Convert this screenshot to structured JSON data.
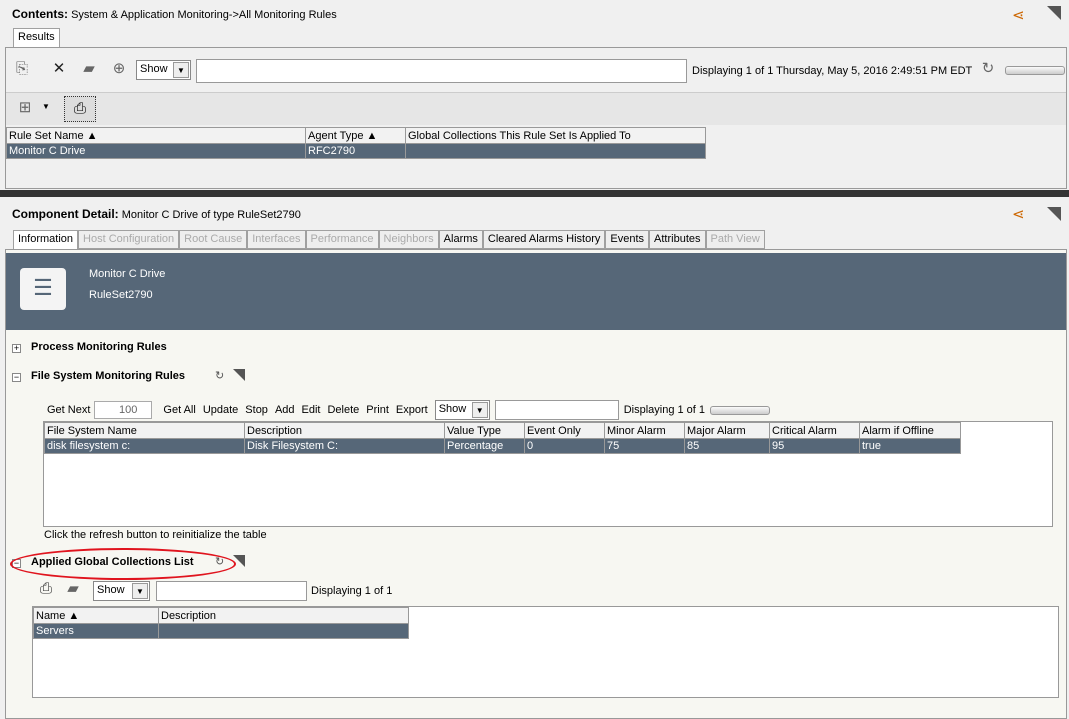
{
  "top": {
    "label": "Contents:",
    "path": "System & Application Monitoring->All Monitoring Rules",
    "tab": "Results",
    "show": "Show",
    "status": "Displaying 1 of 1 Thursday, May 5, 2016 2:49:51 PM EDT",
    "columns": [
      "Rule Set Name",
      "Agent Type",
      "Global Collections This Rule Set Is Applied To"
    ],
    "rows": [
      [
        "Monitor C Drive",
        "RFC2790",
        ""
      ]
    ]
  },
  "detail": {
    "label": "Component Detail:",
    "subject": "Monitor C Drive of type RuleSet2790",
    "tabs": [
      {
        "label": "Information",
        "state": "active"
      },
      {
        "label": "Host Configuration",
        "state": "disabled"
      },
      {
        "label": "Root Cause",
        "state": "disabled"
      },
      {
        "label": "Interfaces",
        "state": "disabled"
      },
      {
        "label": "Performance",
        "state": "disabled"
      },
      {
        "label": "Neighbors",
        "state": "disabled"
      },
      {
        "label": "Alarms",
        "state": "enabled"
      },
      {
        "label": "Cleared Alarms History",
        "state": "enabled"
      },
      {
        "label": "Events",
        "state": "enabled"
      },
      {
        "label": "Attributes",
        "state": "enabled"
      },
      {
        "label": "Path View",
        "state": "disabled"
      }
    ],
    "banner": {
      "name": "Monitor C Drive",
      "type": "RuleSet2790"
    }
  },
  "process": {
    "title": "Process Monitoring Rules"
  },
  "fs": {
    "title": "File System Monitoring Rules",
    "get_next": "Get Next",
    "count": "100",
    "buttons": [
      "Get All",
      "Update",
      "Stop",
      "Add",
      "Edit",
      "Delete",
      "Print",
      "Export"
    ],
    "show": "Show",
    "status": "Displaying 1 of 1",
    "columns": [
      "File System Name",
      "Description",
      "Value Type",
      "Event Only",
      "Minor Alarm",
      "Major Alarm",
      "Critical Alarm",
      "Alarm if Offline"
    ],
    "rows": [
      [
        "disk filesystem c:",
        "Disk Filesystem C:",
        "Percentage",
        "0",
        "75",
        "85",
        "95",
        "true"
      ]
    ],
    "note": "Click the refresh button to reinitialize the table"
  },
  "agc": {
    "title": "Applied Global Collections List",
    "show": "Show",
    "status": "Displaying 1 of 1",
    "columns": [
      "Name",
      "Description"
    ],
    "rows": [
      [
        "Servers",
        ""
      ]
    ]
  },
  "colors": {
    "selected": "#566778",
    "annotation": "#e0141e"
  }
}
